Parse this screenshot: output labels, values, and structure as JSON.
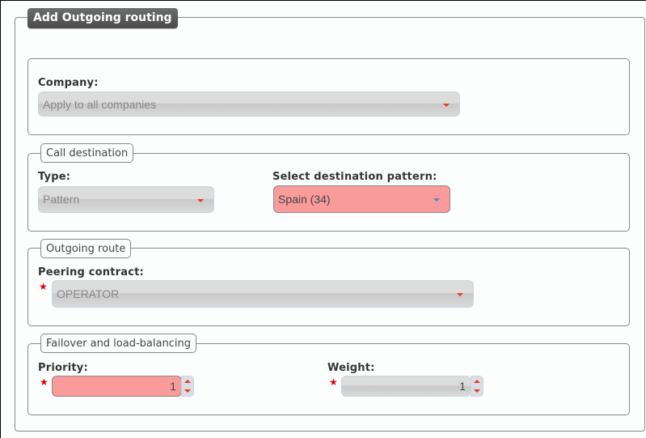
{
  "title": "Add Outgoing routing",
  "company_section": {
    "label": "Company:",
    "select_value": "Apply to all companies"
  },
  "call_destination": {
    "legend": "Call destination",
    "type_label": "Type:",
    "type_value": "Pattern",
    "pattern_label": "Select destination pattern:",
    "pattern_value": "Spain (34)"
  },
  "outgoing_route": {
    "legend": "Outgoing route",
    "peering_label": "Peering contract:",
    "peering_value": "OPERATOR"
  },
  "failover": {
    "legend": "Failover and load-balancing",
    "priority_label": "Priority:",
    "priority_value": "1",
    "weight_label": "Weight:",
    "weight_value": "1"
  },
  "icons": {
    "required": "★"
  },
  "colors": {
    "error_bg": "#f99b9b",
    "arrow_red": "#e53a1f",
    "arrow_blue": "#4a8ad8",
    "title_bg": "#555555"
  }
}
